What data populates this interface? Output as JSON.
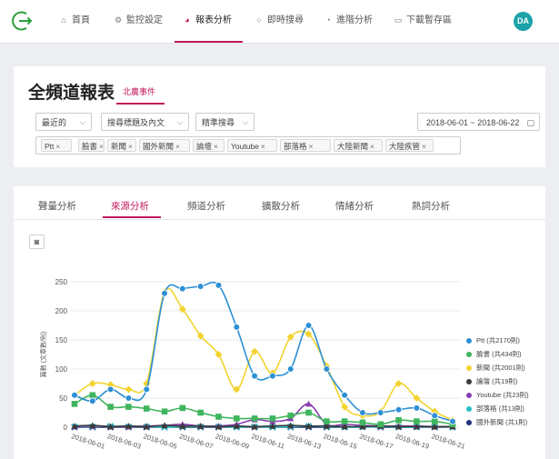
{
  "nav": {
    "items": [
      {
        "label": "首頁",
        "icon": "home-icon",
        "glyph": "⌂",
        "x": 64
      },
      {
        "label": "監控設定",
        "icon": "gear-icon",
        "glyph": "⚙",
        "x": 124
      },
      {
        "label": "報表分析",
        "icon": "pie-chart-icon",
        "glyph": "◕",
        "x": 200,
        "active": true
      },
      {
        "label": "即時搜尋",
        "icon": "search-icon",
        "glyph": "○",
        "x": 279
      },
      {
        "label": "進階分析",
        "icon": "dashboard-icon",
        "glyph": "◔",
        "x": 355
      },
      {
        "label": "下載暫存區",
        "icon": "folder-icon",
        "glyph": "▭",
        "x": 432
      }
    ],
    "avatar": "DA"
  },
  "filter": {
    "title": "全頻道報表",
    "subtab": "北農事件",
    "time_select": "最近的",
    "scope_select": "搜尋標題及內文",
    "mode_select": "精準搜尋",
    "date_range": "2018-06-01 ~ 2018-06-22",
    "tags": [
      "Ptt",
      "臉書",
      "新聞",
      "國外新聞",
      "論壇",
      "Youtube",
      "部落格",
      "大陸新聞",
      "大陸疾管"
    ]
  },
  "chart_tabs": [
    "聲量分析",
    "來源分析",
    "頻道分析",
    "擴散分析",
    "情緒分析",
    "熱詞分析"
  ],
  "active_chart_tab": 1,
  "chart_data": {
    "type": "line",
    "ylabel": "篇數 (文章數/則)",
    "ylim": [
      0,
      250
    ],
    "yticks": [
      0,
      50,
      100,
      150,
      200,
      250
    ],
    "x": [
      "2018-06-01",
      "2018-06-02",
      "2018-06-03",
      "2018-06-04",
      "2018-06-05",
      "2018-06-06",
      "2018-06-07",
      "2018-06-08",
      "2018-06-09",
      "2018-06-10",
      "2018-06-11",
      "2018-06-12",
      "2018-06-13",
      "2018-06-14",
      "2018-06-15",
      "2018-06-16",
      "2018-06-17",
      "2018-06-18",
      "2018-06-19",
      "2018-06-20",
      "2018-06-21",
      "2018-06-22"
    ],
    "xtick_labels": [
      "2018-06-01",
      "2018-06-03",
      "2018-06-05",
      "2018-06-07",
      "2018-06-09",
      "2018-06-11",
      "2018-06-13",
      "2018-06-15",
      "2018-06-17",
      "2018-06-19",
      "2018-06-21"
    ],
    "series": [
      {
        "name": "Ptt (共2170則)",
        "color": "#2d8fd5",
        "marker": "circle",
        "values": [
          55,
          45,
          65,
          50,
          65,
          230,
          238,
          242,
          244,
          172,
          88,
          88,
          100,
          175,
          100,
          55,
          25,
          25,
          30,
          33,
          20,
          10
        ]
      },
      {
        "name": "臉書 (共434則)",
        "color": "#3fb55e",
        "marker": "square",
        "values": [
          40,
          55,
          35,
          35,
          32,
          27,
          33,
          25,
          18,
          15,
          15,
          15,
          20,
          25,
          10,
          10,
          8,
          5,
          12,
          10,
          10,
          5
        ]
      },
      {
        "name": "新聞 (共2001則)",
        "color": "#f2d330",
        "marker": "diamond",
        "values": [
          55,
          75,
          73,
          65,
          75,
          232,
          203,
          157,
          125,
          65,
          130,
          93,
          155,
          160,
          105,
          35,
          20,
          27,
          75,
          50,
          27,
          12
        ]
      },
      {
        "name": "論壇 (共19則)",
        "color": "#3a3a3a",
        "marker": "triangle",
        "values": [
          2,
          3,
          1,
          2,
          1,
          3,
          2,
          2,
          1,
          2,
          1,
          2,
          3,
          2,
          2,
          1,
          1,
          2,
          1,
          1,
          1,
          1
        ]
      },
      {
        "name": "Youtube (共23則)",
        "color": "#8a3fb0",
        "marker": "triangle",
        "values": [
          1,
          2,
          1,
          1,
          2,
          3,
          5,
          2,
          2,
          5,
          13,
          10,
          15,
          40,
          5,
          5,
          3,
          2,
          2,
          2,
          1,
          1
        ]
      },
      {
        "name": "部落格 (共13則)",
        "color": "#25bfc4",
        "marker": "cross",
        "values": [
          1,
          1,
          2,
          1,
          1,
          0,
          1,
          1,
          1,
          0,
          1,
          0,
          1,
          2,
          1,
          0,
          0,
          1,
          0,
          0,
          1,
          0
        ]
      },
      {
        "name": "國外新聞 (共1則)",
        "color": "#1f2f7a",
        "marker": "cross",
        "values": [
          0,
          0,
          0,
          0,
          0,
          0,
          0,
          0,
          0,
          0,
          0,
          0,
          0,
          0,
          0,
          0,
          1,
          0,
          0,
          0,
          0,
          0
        ]
      }
    ]
  }
}
